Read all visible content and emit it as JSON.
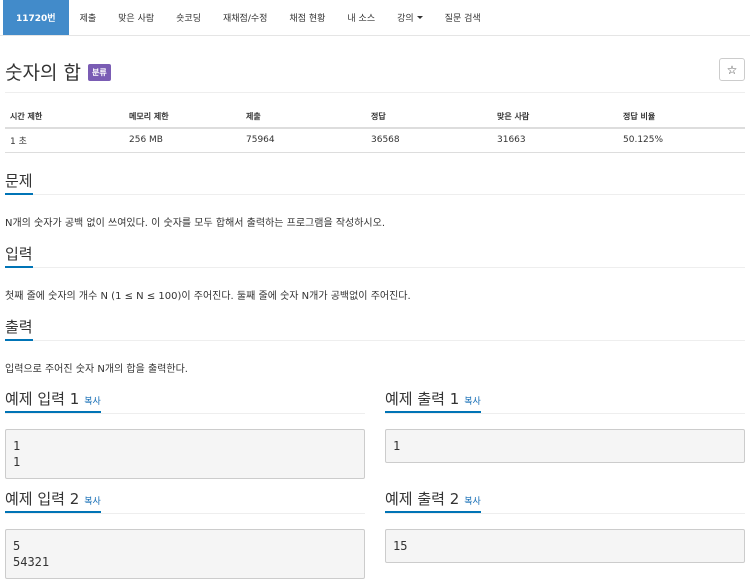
{
  "nav": {
    "items": [
      {
        "label": "11720번",
        "active": true
      },
      {
        "label": "제출"
      },
      {
        "label": "맞은 사람"
      },
      {
        "label": "숏코딩"
      },
      {
        "label": "재채점/수정"
      },
      {
        "label": "채점 현황"
      },
      {
        "label": "내 소스"
      },
      {
        "label": "강의"
      },
      {
        "label": "질문 검색"
      }
    ]
  },
  "problem": {
    "title": "숫자의 합",
    "badge": "분류",
    "star": "☆"
  },
  "stats": {
    "headers": [
      "시간 제한",
      "메모리 제한",
      "제출",
      "정답",
      "맞은 사람",
      "정답 비율"
    ],
    "values": [
      "1 초",
      "256 MB",
      "75964",
      "36568",
      "31663",
      "50.125%"
    ]
  },
  "sections": {
    "description": {
      "title": "문제",
      "text": "N개의 숫자가 공백 없이 쓰여있다. 이 숫자를 모두 합해서 출력하는 프로그램을 작성하시오."
    },
    "input": {
      "title": "입력",
      "text": "첫째 줄에 숫자의 개수 N (1 ≤ N ≤ 100)이 주어진다. 둘째 줄에 숫자 N개가 공백없이 주어진다."
    },
    "output": {
      "title": "출력",
      "text": "입력으로 주어진 숫자 N개의 합을 출력한다."
    }
  },
  "samples": {
    "copy_label": "복사",
    "input1": {
      "title": "예제 입력 1",
      "content": "1\n1"
    },
    "output1": {
      "title": "예제 출력 1",
      "content": "1"
    },
    "input2": {
      "title": "예제 입력 2",
      "content": "5\n54321"
    },
    "output2": {
      "title": "예제 출력 2",
      "content": "15"
    }
  }
}
